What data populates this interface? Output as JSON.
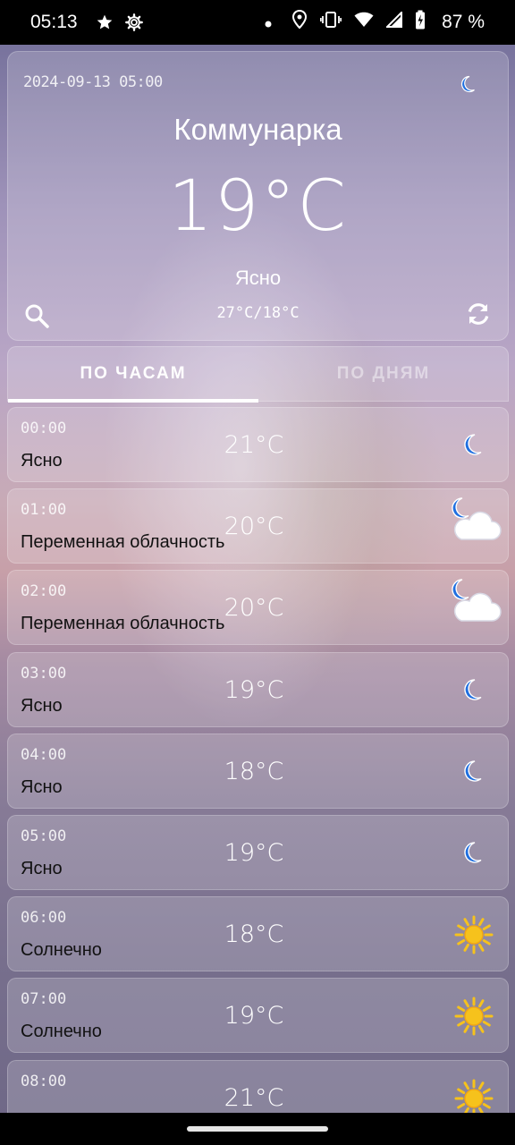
{
  "status_bar": {
    "time": "05:13",
    "battery_percent": "87 %"
  },
  "header": {
    "datetime": "2024-09-13 05:00",
    "city": "Коммунарка",
    "temperature": "19°C",
    "condition": "Ясно",
    "range": "27°C/18°C",
    "icon": "moon-icon"
  },
  "tabs": [
    {
      "label": "ПО ЧАСАМ",
      "active": true
    },
    {
      "label": "ПО ДНЯМ",
      "active": false
    }
  ],
  "hourly": [
    {
      "time": "00:00",
      "condition": "Ясно",
      "temp": "21°C",
      "icon": "moon-icon"
    },
    {
      "time": "01:00",
      "condition": "Переменная облачность",
      "temp": "20°C",
      "icon": "partly-cloudy-night-icon"
    },
    {
      "time": "02:00",
      "condition": "Переменная облачность",
      "temp": "20°C",
      "icon": "partly-cloudy-night-icon"
    },
    {
      "time": "03:00",
      "condition": "Ясно",
      "temp": "19°C",
      "icon": "moon-icon"
    },
    {
      "time": "04:00",
      "condition": "Ясно",
      "temp": "18°C",
      "icon": "moon-icon"
    },
    {
      "time": "05:00",
      "condition": "Ясно",
      "temp": "19°C",
      "icon": "moon-icon"
    },
    {
      "time": "06:00",
      "condition": "Солнечно",
      "temp": "18°C",
      "icon": "sun-icon"
    },
    {
      "time": "07:00",
      "condition": "Солнечно",
      "temp": "19°C",
      "icon": "sun-icon"
    },
    {
      "time": "08:00",
      "condition": "",
      "temp": "21°C",
      "icon": "sun-icon"
    }
  ],
  "colors": {
    "moon": "#1f6fe0",
    "sun": "#f6c21c",
    "cloud": "#ffffff"
  }
}
